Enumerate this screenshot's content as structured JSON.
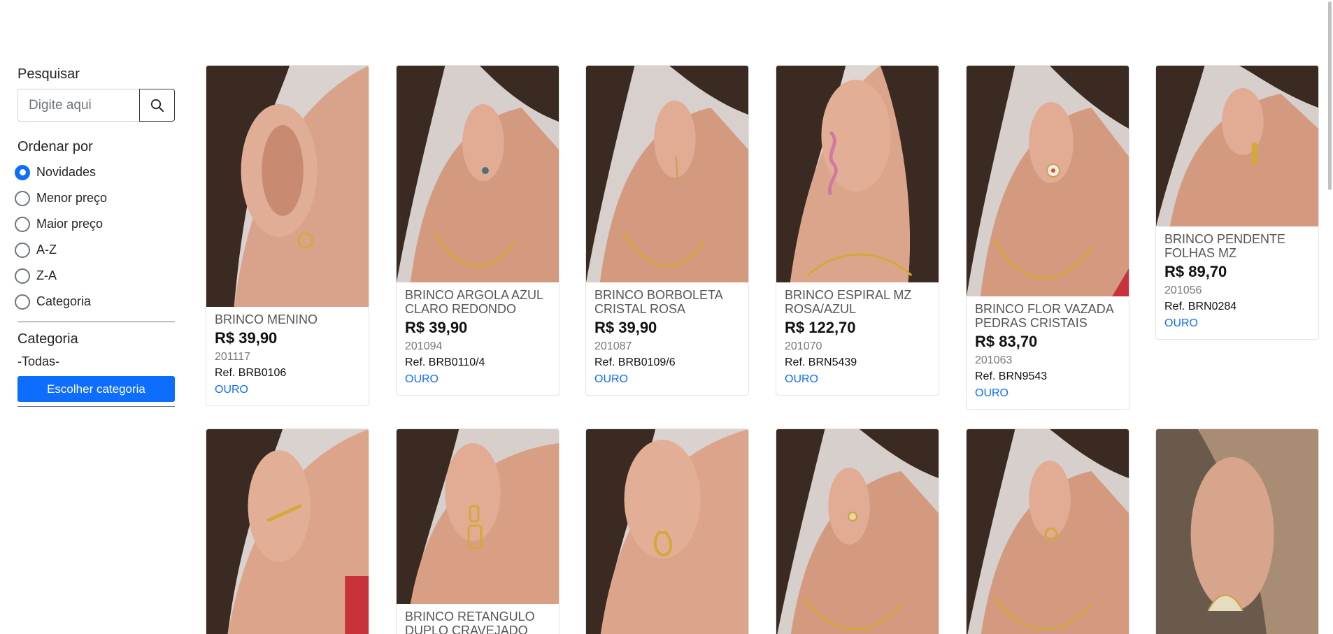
{
  "sidebar": {
    "search_label": "Pesquisar",
    "search_placeholder": "Digite aqui",
    "order_label": "Ordenar por",
    "order_options": [
      "Novidades",
      "Menor preço",
      "Maior preço",
      "A-Z",
      "Z-A",
      "Categoria"
    ],
    "order_selected": "Novidades",
    "category_label": "Categoria",
    "category_value": "-Todas-",
    "category_button": "Escolher categoria"
  },
  "products": [
    {
      "name": "BRINCO MENINO",
      "price": "R$ 39,90",
      "code": "201117",
      "ref": "Ref. BRB0106",
      "material": "OURO"
    },
    {
      "name": "BRINCO ARGOLA AZUL CLARO REDONDO",
      "price": "R$ 39,90",
      "code": "201094",
      "ref": "Ref. BRB0110/4",
      "material": "OURO"
    },
    {
      "name": "BRINCO BORBOLETA CRISTAL ROSA",
      "price": "R$ 39,90",
      "code": "201087",
      "ref": "Ref. BRB0109/6",
      "material": "OURO"
    },
    {
      "name": "BRINCO ESPIRAL MZ ROSA/AZUL",
      "price": "R$ 122,70",
      "code": "201070",
      "ref": "Ref. BRN5439",
      "material": "OURO"
    },
    {
      "name": "BRINCO FLOR VAZADA PEDRAS CRISTAIS",
      "price": "R$ 83,70",
      "code": "201063",
      "ref": "Ref. BRN9543",
      "material": "OURO"
    },
    {
      "name": "BRINCO PENDENTE FOLHAS MZ",
      "price": "R$ 89,70",
      "code": "201056",
      "ref": "Ref. BRN0284",
      "material": "OURO"
    },
    {
      "name": "",
      "price": "",
      "code": "",
      "ref": "",
      "material": ""
    },
    {
      "name": "BRINCO RETANGULO DUPLO CRAVEJADO",
      "price": "",
      "code": "",
      "ref": "",
      "material": ""
    },
    {
      "name": "",
      "price": "",
      "code": "",
      "ref": "",
      "material": ""
    },
    {
      "name": "",
      "price": "",
      "code": "",
      "ref": "",
      "material": ""
    },
    {
      "name": "",
      "price": "",
      "code": "",
      "ref": "",
      "material": ""
    },
    {
      "name": "",
      "price": "",
      "code": "",
      "ref": "",
      "material": ""
    }
  ]
}
